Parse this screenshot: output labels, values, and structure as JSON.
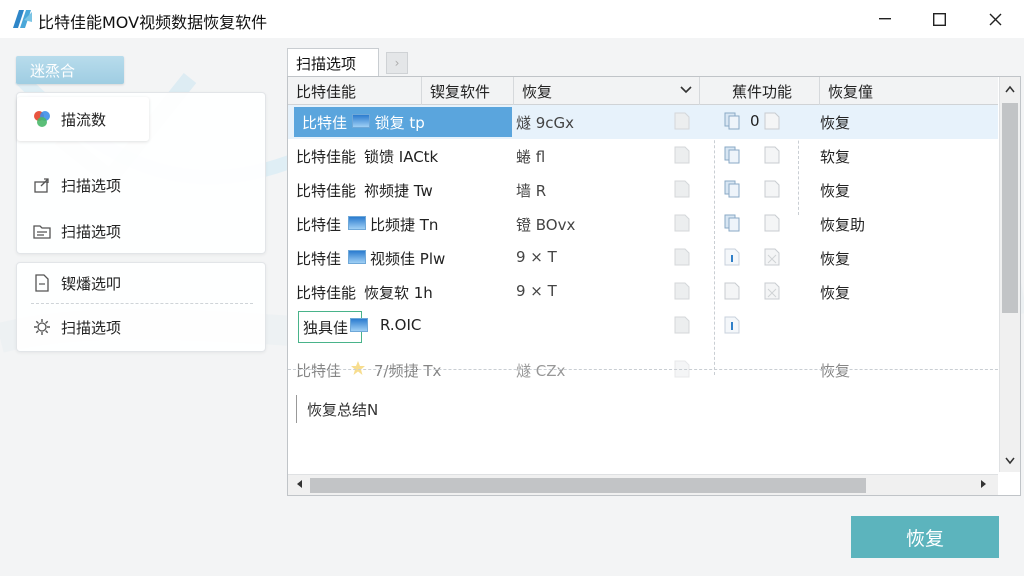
{
  "window": {
    "title": "比特佳能MOV视频数据恢复软件"
  },
  "sidebar": {
    "tag": "迷烝合",
    "active_item": "描流数",
    "items_top": [
      "扫描选项",
      "扫描选项"
    ],
    "items_bottom": [
      "锲燔选叩",
      "扫描选项"
    ]
  },
  "tabs": {
    "active": "扫描选项"
  },
  "table": {
    "headers": [
      "比特佳能",
      "锲复软件",
      "恢复",
      "蕉件功能",
      "恢复僮"
    ],
    "rows": [
      {
        "name": "比特佳",
        "type": "锁复 tp",
        "recover": "燧 9cGx",
        "status": "恢复",
        "selected": true,
        "thumb": true,
        "f1_label": "0"
      },
      {
        "name": "比特佳能",
        "type": "锁馈 IACtk",
        "recover": "蜷 fl",
        "status": "软复",
        "selected": false,
        "thumb": false,
        "f1_label": ""
      },
      {
        "name": "比特佳能",
        "type": "祢频捷 Tw",
        "recover": "墙 R",
        "status": "恢复",
        "selected": false,
        "thumb": false,
        "f1_label": ""
      },
      {
        "name": "比特佳",
        "type": "比频捷 Tn",
        "recover": "镫 BOvx",
        "status": "恢复助",
        "selected": false,
        "thumb": true,
        "f1_label": ""
      },
      {
        "name": "比特佳",
        "type": "视频佳 Plw",
        "recover": "9 × T",
        "status": "恢复",
        "selected": false,
        "thumb": true,
        "f1_label": ""
      },
      {
        "name": "比特佳能",
        "type": "恢复软 1h",
        "recover": "9 × T",
        "status": "恢复",
        "selected": false,
        "thumb": false,
        "f1_label": ""
      },
      {
        "name": "独具佳",
        "type": "R.OIC",
        "recover": "",
        "status": "",
        "selected": false,
        "thumb": true,
        "f1_label": ""
      },
      {
        "name": "比特佳",
        "type": "7/频捷 Tx",
        "recover": "燧 CZx",
        "status": "恢复",
        "selected": false,
        "thumb": false,
        "f1_label": ""
      }
    ],
    "input_text": "恢复总结N"
  },
  "actions": {
    "recover_label": "恢复"
  },
  "colors": {
    "accent": "#5cb4bd",
    "selection": "#5aa5dd",
    "tag": "#a6d1e5"
  }
}
